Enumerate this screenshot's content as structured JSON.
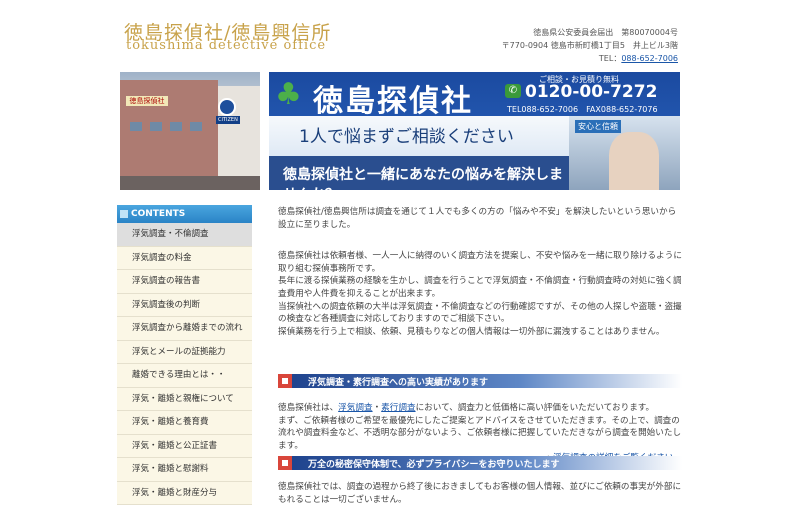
{
  "header": {
    "logo_jp": "徳島探偵社/徳島興信所",
    "logo_en": "tokushima detective office",
    "license": "徳島県公安委員会届出　第80070004号",
    "address": "〒770-0904 徳島市新町橋1丁目5　井上ビル3階",
    "tel_label": "TEL：",
    "tel": "088-652-7006"
  },
  "photo": {
    "sign": "徳島探偵社",
    "clock_brand": "CITIZEN"
  },
  "banner": {
    "name": "徳島探偵社",
    "free_label": "ご相談・お見積り無料",
    "free_number": "0120-00-7272",
    "tel_fax": "TEL088-652-7006　FAX088-652-7076",
    "slogan1": "1人で悩まずご相談ください",
    "slogan2": "徳島探偵社と一緒にあなたの悩みを解決しませんか？",
    "photo_caption": "安心と信頼"
  },
  "sidebar": {
    "heading": "CONTENTS",
    "items": [
      "浮気調査・不倫調査",
      "浮気調査の料金",
      "浮気調査の報告書",
      "浮気調査後の判断",
      "浮気調査から離婚までの流れ",
      "浮気とメールの証拠能力",
      "離婚できる理由とは・・",
      "浮気・離婚と親権について",
      "浮気・離婚と養育費",
      "浮気・離婚と公正証書",
      "浮気・離婚と慰謝料",
      "浮気・離婚と財産分与"
    ]
  },
  "main": {
    "intro": "徳島探偵社/徳島興信所は調査を通じて１人でも多くの方の「悩みや不安」を解決したいという思いから設立に至りました。",
    "p2": "徳島探偵社は依頼者様、一人一人に納得のいく調査方法を提案し、不安や悩みを一緒に取り除けるように取り組む探偵事務所です。",
    "p3": "長年に渡る探偵業務の経験を生かし、調査を行うことで浮気調査・不倫調査・行動調査時の対処に強く調査費用や人件費を抑えることが出来ます。",
    "p4": "当探偵社への調査依頼の大半は浮気調査・不倫調査などの行動確認ですが、その他の人探しや盗聴・盗撮の検査など各種調査に対応しておりますのでご相談下さい。",
    "p5": "探偵業務を行う上で相談、依頼、見積もりなどの個人情報は一切外部に漏洩することはありません。"
  },
  "section1": {
    "title": "浮気調査・素行調査への高い実績があります",
    "text_a": "徳島探偵社は、",
    "link1": "浮気調査",
    "sep": "・",
    "link2": "素行調査",
    "text_b": "において、調査力と低価格に高い評価をいただいております。",
    "text_c": "まず、ご依頼者様のご希望を最優先にしたご提案とアドバイスをさせていただきます。その上で、調査の流れや調査料金など、不透明な部分がないよう、ご依頼者様に把握していただきながら調査を開始いたします。",
    "more_arrow": "→",
    "more_link": "浮気調査の詳細をご覧ください。"
  },
  "section2": {
    "title": "万全の秘密保守体制で、必ずプライバシーをお守りいたします",
    "text": "徳島探偵社では、調査の過程から終了後におきましてもお客様の個人情報、並びにご依頼の事実が外部にもれることは一切ございません。"
  }
}
